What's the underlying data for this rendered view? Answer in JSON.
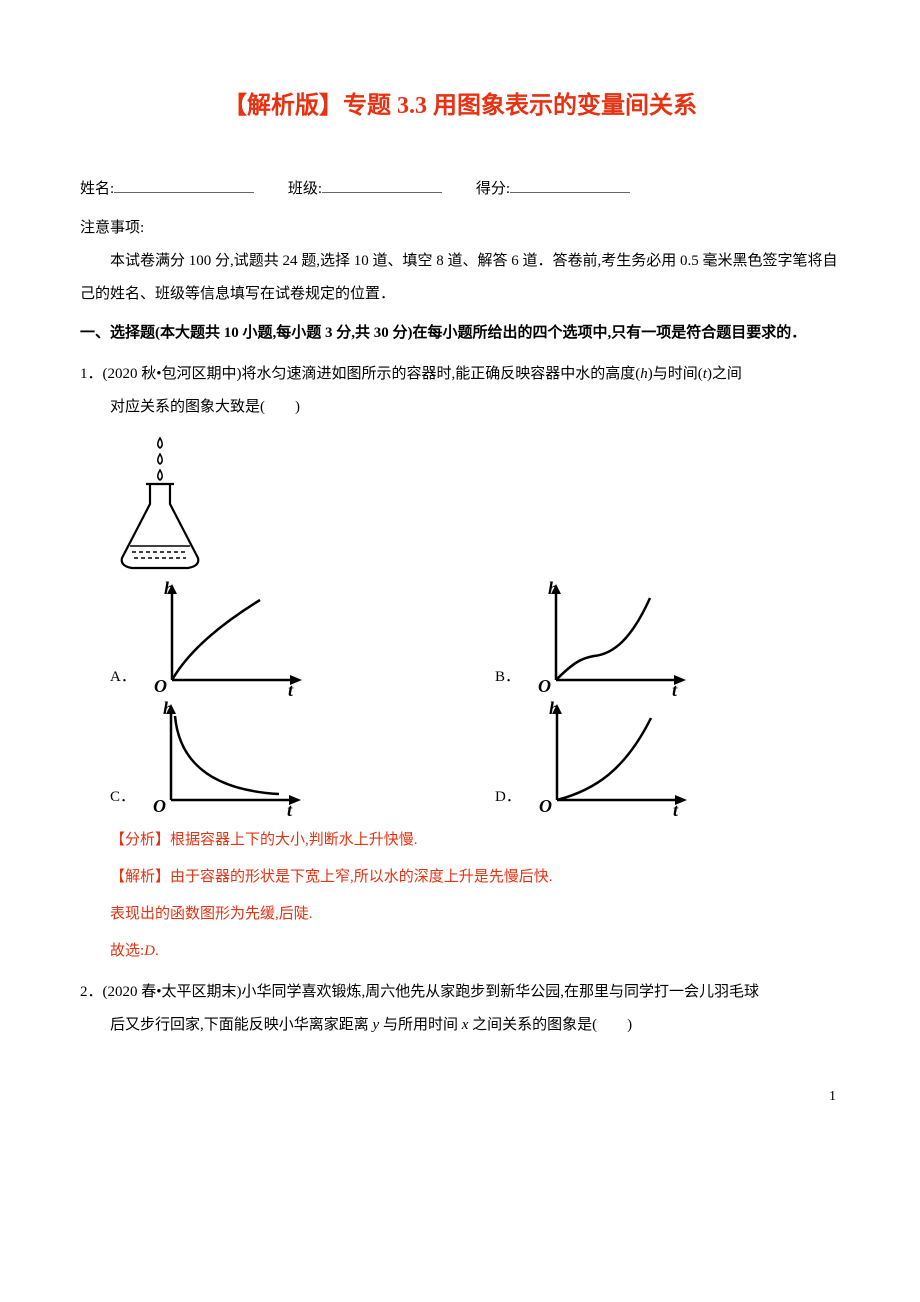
{
  "title": "【解析版】专题 3.3 用图象表示的变量间关系",
  "info": {
    "name_label": "姓名:",
    "class_label": "班级:",
    "score_label": "得分:"
  },
  "notes": {
    "heading": "注意事项:",
    "body": "本试卷满分 100 分,试题共 24 题,选择 10 道、填空 8 道、解答 6 道．答卷前,考生务必用 0.5 毫米黑色签字笔将自己的姓名、班级等信息填写在试卷规定的位置．"
  },
  "section1": "一、选择题(本大题共 10 小题,每小题 3 分,共 30 分)在每小题所给出的四个选项中,只有一项是符合题目要求的．",
  "q1": {
    "num": "1．",
    "src": "(2020 秋•包河区期中)",
    "body_a": "将水匀速滴进如图所示的容器时,能正确反映容器中水的高度(",
    "h": "h",
    "body_b": ")与时间(",
    "t": "t",
    "body_c": ")之间",
    "body_line2": "对应关系的图象大致是(　　)",
    "letters": {
      "a": "A．",
      "b": "B．",
      "c": "C．",
      "d": "D．"
    },
    "analysis_tag": "【分析】",
    "analysis_body": "根据容器上下的大小,判断水上升快慢.",
    "solution_tag": "【解析】",
    "solution_body": "由于容器的形状是下宽上窄,所以水的深度上升是先慢后快.",
    "solution_line2": "表现出的函数图形为先缓,后陡.",
    "answer_pre": "故选:",
    "answer_opt": "D",
    "answer_post": "."
  },
  "q2": {
    "num": "2．",
    "src": "(2020 春•太平区期末)",
    "body_a": "小华同学喜欢锻炼,周六他先从家跑步到新华公园,在那里与同学打一会儿羽毛球",
    "body_line2_a": "后又步行回家,下面能反映小华离家距离 ",
    "y": "y",
    "body_line2_b": " 与所用时间 ",
    "x": "x",
    "body_line2_c": " 之间关系的图象是(　　)"
  },
  "page_number": "1"
}
